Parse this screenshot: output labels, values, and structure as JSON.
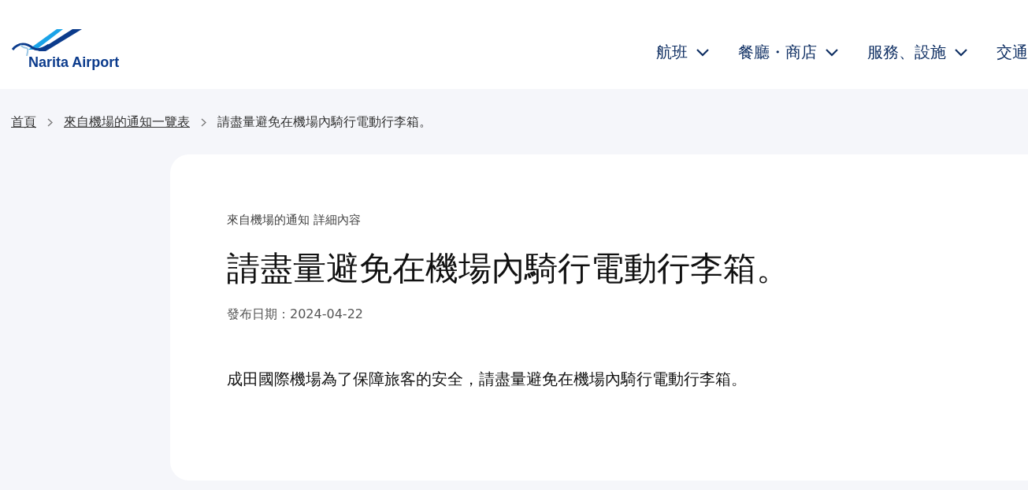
{
  "header": {
    "logo": "Narita Airport",
    "nav": [
      {
        "label": "航班",
        "dropdown": true
      },
      {
        "label": "餐廳・商店",
        "dropdown": true
      },
      {
        "label": "服務、設施",
        "dropdown": true
      },
      {
        "label": "交通",
        "dropdown": false
      }
    ]
  },
  "breadcrumb": [
    {
      "label": "首頁",
      "link": true
    },
    {
      "label": "來自機場的通知一覽表",
      "link": true
    },
    {
      "label": "請盡量避免在機場內騎行電動行李箱。",
      "link": false
    }
  ],
  "article": {
    "category": "來自機場的通知 詳細內容",
    "title": "請盡量避免在機場內騎行電動行李箱。",
    "date": "發布日期：2024-04-22",
    "body": "成田國際機場為了保障旅客的安全，請盡量避免在機場內騎行電動行李箱。"
  }
}
